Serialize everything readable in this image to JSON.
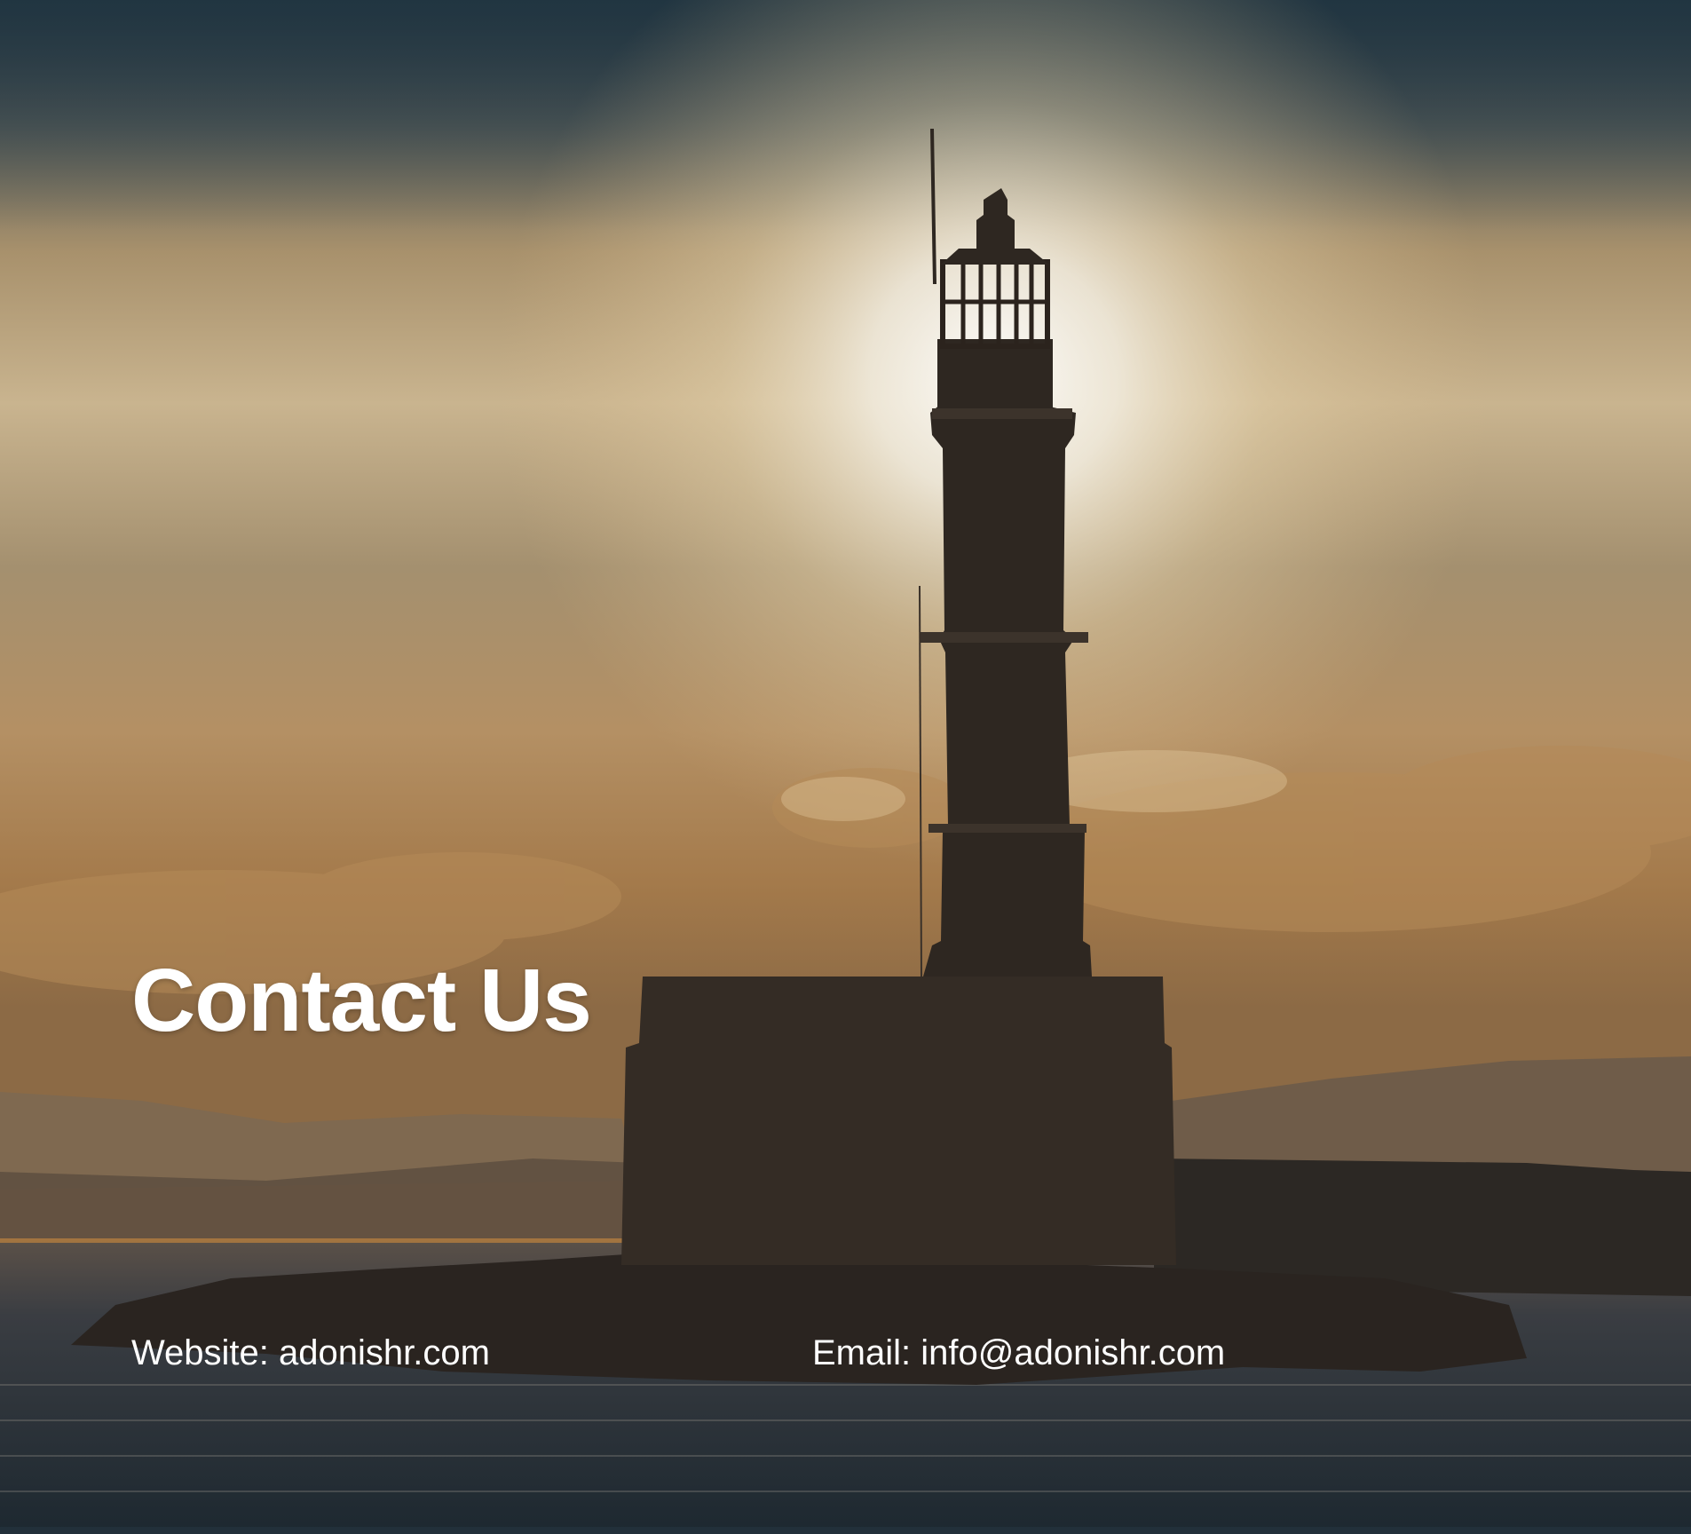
{
  "slide": {
    "title": "Contact Us",
    "website_line": "Website: adonishr.com",
    "email_line": "Email: info@adonishr.com",
    "background": {
      "image": "lighthouse silhouette at sunset over the sea",
      "sky_colors": [
        "#33424c",
        "#d9c7a4",
        "#efe9dd",
        "#c99a5c",
        "#8a6b45"
      ],
      "sea_color": "#2b333b"
    },
    "text_color": "#ffffff"
  }
}
